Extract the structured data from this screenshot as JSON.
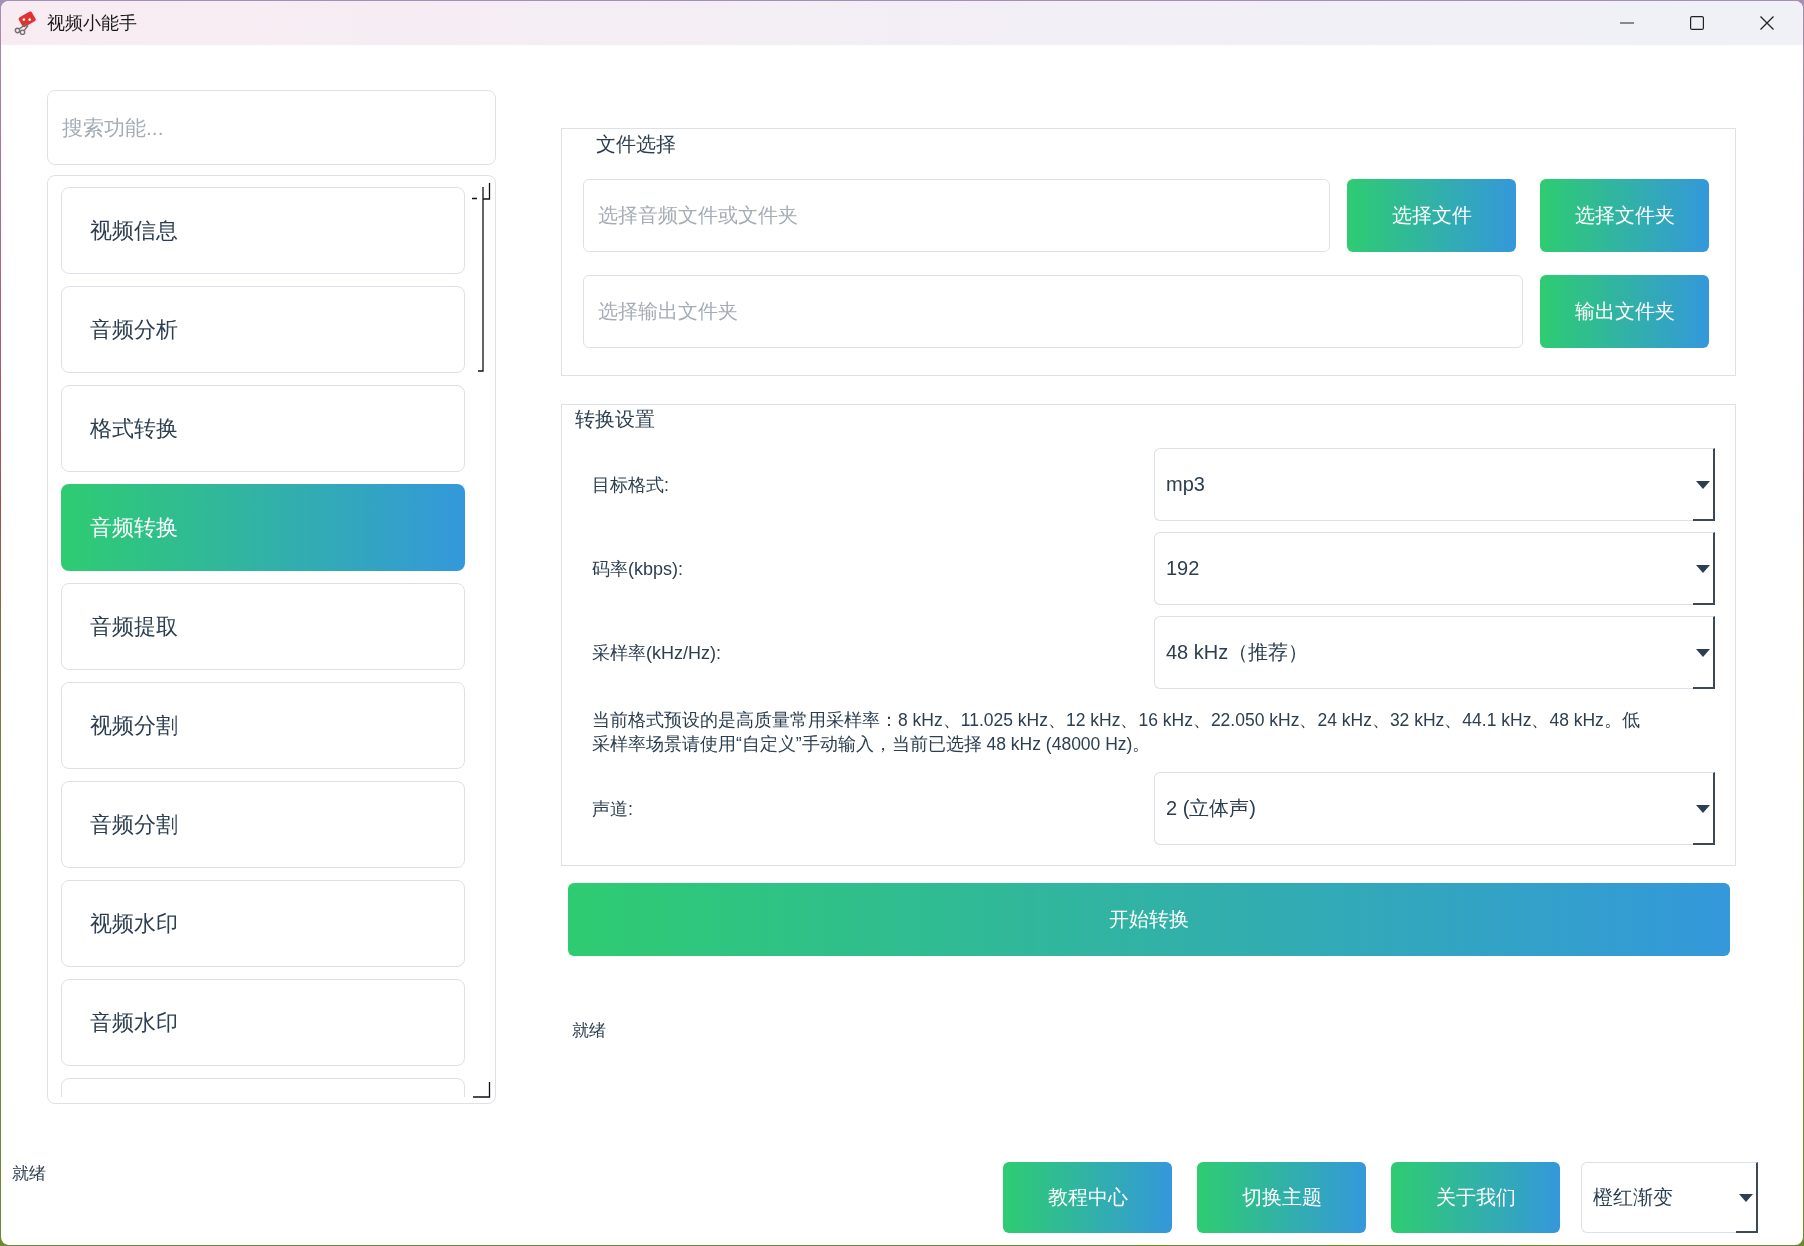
{
  "window": {
    "title": "视频小能手"
  },
  "sidebar": {
    "search": {
      "placeholder": "搜索功能..."
    },
    "items": [
      {
        "label": "视频信息",
        "selected": false
      },
      {
        "label": "音频分析",
        "selected": false
      },
      {
        "label": "格式转换",
        "selected": false
      },
      {
        "label": "音频转换",
        "selected": true
      },
      {
        "label": "音频提取",
        "selected": false
      },
      {
        "label": "视频分割",
        "selected": false
      },
      {
        "label": "音频分割",
        "selected": false
      },
      {
        "label": "视频水印",
        "selected": false
      },
      {
        "label": "音频水印",
        "selected": false
      }
    ]
  },
  "file_selection": {
    "title": "文件选择",
    "rows": [
      {
        "field": {
          "placeholder": "选择音频文件或文件夹"
        },
        "buttons": [
          "选择文件",
          "选择文件夹"
        ]
      },
      {
        "field": {
          "placeholder": "选择输出文件夹"
        },
        "buttons": [
          "输出文件夹"
        ]
      }
    ]
  },
  "conversion_settings": {
    "title": "转换设置",
    "rows": [
      {
        "kind": "select",
        "label": "目标格式:",
        "value": "mp3"
      },
      {
        "kind": "select",
        "label": "码率(kbps):",
        "value": "192"
      },
      {
        "kind": "select",
        "label": "采样率(kHz/Hz):",
        "value": "48 kHz（推荐）"
      },
      {
        "kind": "note",
        "text": "当前格式预设的是高质量常用采样率：8 kHz、11.025 kHz、12 kHz、16 kHz、22.050 kHz、24 kHz、32 kHz、44.1 kHz、48 kHz。低采样率场景请使用“自定义”手动输入，当前已选择 48 kHz (48000 Hz)。"
      },
      {
        "kind": "select",
        "label": "声道:",
        "value": "2 (立体声)"
      }
    ]
  },
  "start_button": "开始转换",
  "status": "就绪",
  "footer": {
    "status": "就绪",
    "buttons": [
      "教程中心",
      "切换主题",
      "关于我们"
    ],
    "theme_select": {
      "value": "橙红渐变"
    }
  }
}
